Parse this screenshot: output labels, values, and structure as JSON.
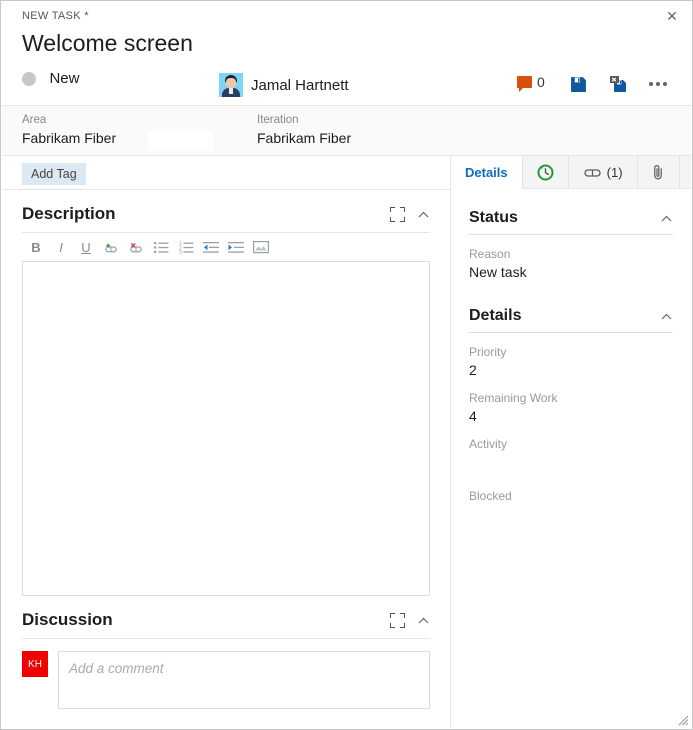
{
  "window": {
    "breadcrumb": "NEW TASK *",
    "title": "Welcome screen",
    "close_label": "✕",
    "accent_color": "#f2c811"
  },
  "header": {
    "state": "New",
    "state_color": "#c8c8c8",
    "assignee": "Jamal Hartnett",
    "avatar_name": "person-avatar",
    "comment_count": "0",
    "comment_icon_color": "#d8500e",
    "actions": [
      {
        "name": "save-button",
        "label": "Save"
      },
      {
        "name": "save-and-close-button",
        "label": "Save and Close"
      },
      {
        "name": "more-actions-button",
        "label": "More actions"
      }
    ]
  },
  "classification": {
    "area_label": "Area",
    "area_value": "Fabrikam Fiber",
    "iteration_label": "Iteration",
    "iteration_value": "Fabrikam Fiber",
    "add_tag_label": "Add Tag"
  },
  "description": {
    "title": "Description",
    "expand_label": "Expand",
    "collapse_label": "Collapse",
    "content": "",
    "toolbar": [
      {
        "name": "bold-icon",
        "glyph": "B",
        "title": "Bold"
      },
      {
        "name": "italic-icon",
        "glyph": "I",
        "title": "Italic"
      },
      {
        "name": "underline-icon",
        "glyph": "U",
        "title": "Underline"
      },
      {
        "name": "insert-link-icon",
        "glyph": "",
        "title": "Insert link"
      },
      {
        "name": "remove-link-icon",
        "glyph": "",
        "title": "Remove link"
      },
      {
        "name": "bulleted-list-icon",
        "glyph": "",
        "title": "Bulleted list"
      },
      {
        "name": "numbered-list-icon",
        "glyph": "",
        "title": "Numbered list"
      },
      {
        "name": "outdent-icon",
        "glyph": "",
        "title": "Decrease indent"
      },
      {
        "name": "indent-icon",
        "glyph": "",
        "title": "Increase indent"
      },
      {
        "name": "insert-image-icon",
        "glyph": "",
        "title": "Insert image"
      }
    ]
  },
  "discussion": {
    "title": "Discussion",
    "avatar_initials": "KH",
    "avatar_color": "#f00000",
    "comment_placeholder": "Add a comment"
  },
  "tabs": [
    {
      "name": "tab-details",
      "label": "Details",
      "icon": "",
      "active": true
    },
    {
      "name": "tab-history",
      "label": "",
      "icon": "history-icon",
      "active": false
    },
    {
      "name": "tab-links",
      "label": "(1)",
      "icon": "link-icon",
      "active": false
    },
    {
      "name": "tab-attachments",
      "label": "",
      "icon": "paperclip-icon",
      "active": false
    }
  ],
  "details_panel": {
    "status_section": {
      "title": "Status",
      "fields": [
        {
          "label": "Reason",
          "value": "New task"
        }
      ]
    },
    "details_section": {
      "title": "Details",
      "fields": [
        {
          "label": "Priority",
          "value": "2"
        },
        {
          "label": "Remaining Work",
          "value": "4"
        },
        {
          "label": "Activity",
          "value": ""
        },
        {
          "label": "Blocked",
          "value": ""
        }
      ]
    }
  }
}
